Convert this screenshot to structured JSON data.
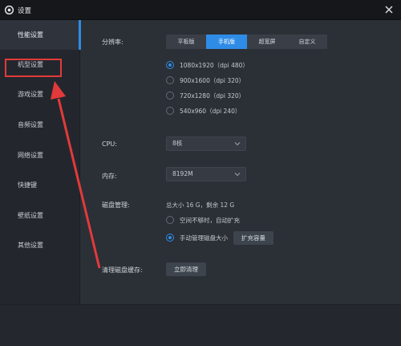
{
  "window": {
    "title": "设置",
    "logo_icon": "gear-logo-icon",
    "close_icon": "close-icon"
  },
  "sidebar": {
    "items": [
      {
        "label": "性能设置",
        "active": true
      },
      {
        "label": "机型设置",
        "active": false
      },
      {
        "label": "游戏设置",
        "active": false
      },
      {
        "label": "音频设置",
        "active": false
      },
      {
        "label": "网络设置",
        "active": false
      },
      {
        "label": "快捷键",
        "active": false
      },
      {
        "label": "壁纸设置",
        "active": false
      },
      {
        "label": "其他设置",
        "active": false
      }
    ]
  },
  "resolution": {
    "label": "分辨率:",
    "tabs": [
      "平板版",
      "手机版",
      "超宽屏",
      "自定义"
    ],
    "active_tab": "手机版",
    "options": [
      "1080x1920（dpi 480）",
      "900x1600（dpi 320）",
      "720x1280（dpi 320）",
      "540x960（dpi 240）"
    ],
    "selected_option": "1080x1920（dpi 480）"
  },
  "cpu": {
    "label": "CPU:",
    "value": "8核"
  },
  "memory": {
    "label": "内存:",
    "value": "8192M"
  },
  "disk": {
    "label": "磁盘管理:",
    "summary": "总大小 16 G，剩余 12 G",
    "options": [
      "空间不够时，自动扩充",
      "手动管理磁盘大小"
    ],
    "selected_option": "手动管理磁盘大小",
    "expand_button": "扩充容量"
  },
  "cache": {
    "label": "清理磁盘缓存:",
    "button": "立即清理"
  },
  "colors": {
    "accent": "#2f8ce6",
    "annotation": "#e23a3a",
    "sidebar_bg": "#23272d",
    "main_bg": "#2b2f36"
  }
}
